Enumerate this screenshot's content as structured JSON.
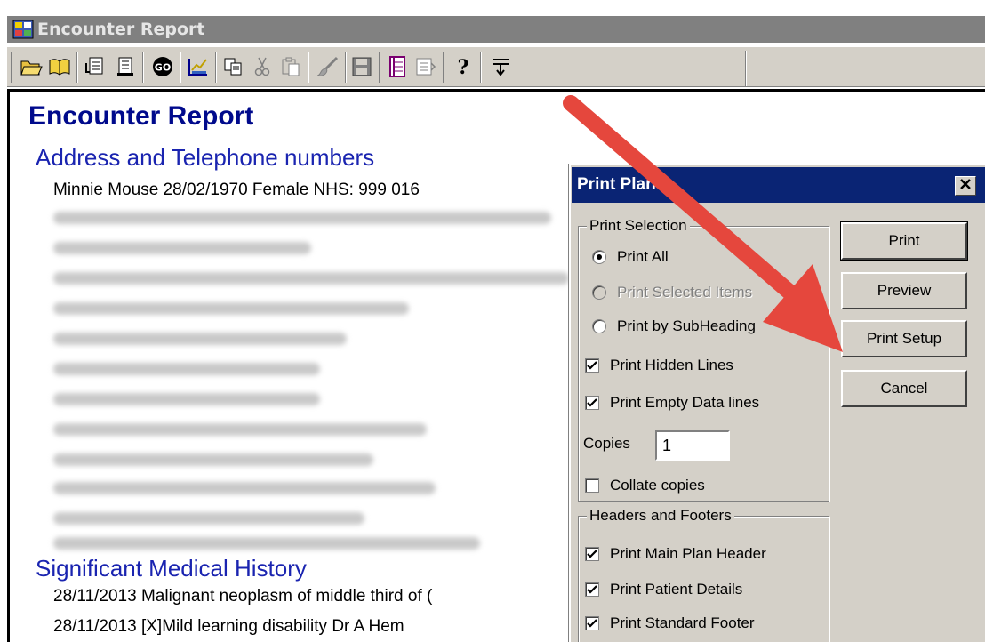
{
  "window": {
    "title": "Encounter Report",
    "icon": "app-icon"
  },
  "toolbar": {
    "buttons": [
      {
        "name": "open-folder-icon"
      },
      {
        "name": "book-icon"
      },
      {
        "name": "document-arrow-icon"
      },
      {
        "name": "document-list-icon"
      },
      {
        "name": "go-icon",
        "label": "GO"
      },
      {
        "name": "chart-icon"
      },
      {
        "name": "copy-icon"
      },
      {
        "name": "cut-icon"
      },
      {
        "name": "paste-icon"
      },
      {
        "name": "brush-icon"
      },
      {
        "name": "save-icon"
      },
      {
        "name": "print-plan-icon"
      },
      {
        "name": "grid-icon"
      },
      {
        "name": "help-icon",
        "label": "?"
      },
      {
        "name": "filter-lines-icon"
      }
    ]
  },
  "report": {
    "title": "Encounter Report",
    "address_heading": "Address and Telephone numbers",
    "patient_line": "Minnie Mouse 28/02/1970 Female  NHS: 999 016",
    "history_heading": "Significant Medical History",
    "history_lines": [
      "28/11/2013 Malignant neoplasm of middle third of (",
      "28/11/2013 [X]Mild learning disability       Dr A Hem"
    ]
  },
  "dialog": {
    "title": "Print Plan",
    "print_selection": {
      "label": "Print Selection",
      "options": [
        {
          "label": "Print All",
          "checked": true,
          "enabled": true
        },
        {
          "label": "Print Selected Items",
          "checked": false,
          "enabled": false
        },
        {
          "label": "Print by SubHeading",
          "checked": false,
          "enabled": true
        }
      ],
      "checkboxes": [
        {
          "label": "Print Hidden Lines",
          "checked": true
        },
        {
          "label": "Print Empty Data lines",
          "checked": true
        }
      ],
      "copies_label": "Copies",
      "copies_value": "1",
      "collate": {
        "label": "Collate copies",
        "checked": false
      }
    },
    "headers_footers": {
      "label": "Headers and Footers",
      "checkboxes": [
        {
          "label": "Print Main Plan Header",
          "checked": true
        },
        {
          "label": "Print Patient Details",
          "checked": true
        },
        {
          "label": "Print Standard Footer",
          "checked": true
        }
      ]
    },
    "buttons": {
      "print": "Print",
      "preview": "Preview",
      "print_setup": "Print Setup",
      "cancel": "Cancel"
    }
  },
  "colors": {
    "dialog_title_bg": "#0a2474",
    "window_title_bg": "#808080",
    "report_heading": "#000a8c",
    "annotation_arrow": "#e5473d"
  }
}
